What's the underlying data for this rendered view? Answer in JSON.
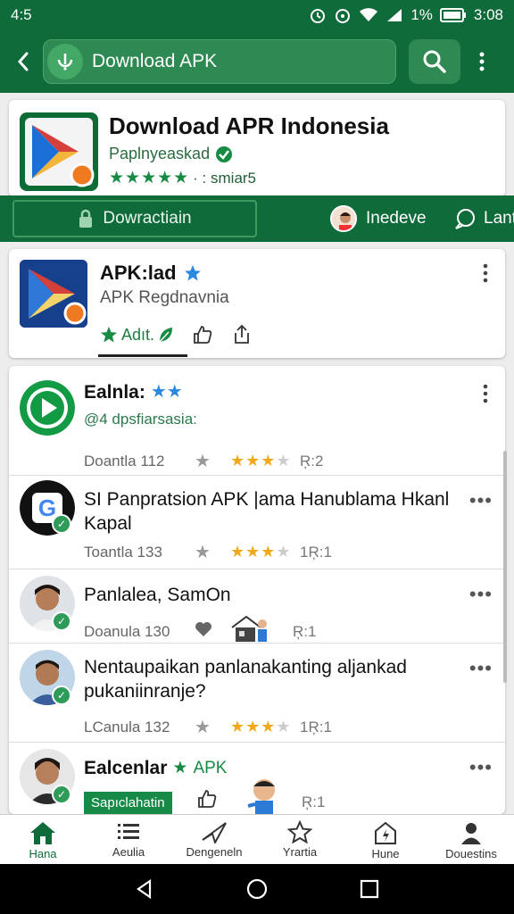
{
  "status": {
    "time": "4:5",
    "battery": "1%",
    "clock": "3:08"
  },
  "appbar": {
    "back_label": "Back",
    "search_text": "Download APK"
  },
  "hero": {
    "title": "Download APR Indonesia",
    "publisher": "Paplnyeaskad",
    "stars": "★★★★★",
    "rating_text": "· : smiar5"
  },
  "actions": {
    "download_label": "Dowractiain",
    "second_label": "Inedeve",
    "third_label": "Lant"
  },
  "apk_card": {
    "name": "APK:lad",
    "subtitle": "APK Regdnavnia",
    "add_label": "Adıt."
  },
  "feed": {
    "items": [
      {
        "title": "Ealnla:",
        "subtitle": "@4 dpsfiarsasia:",
        "meta_label": "Doantla 112",
        "count": "Ŗ:2"
      },
      {
        "title": "SI Panpratsion APK |ama Hanublama Hkanl Kapal",
        "meta_label": "Toantla 133",
        "count": "1Ŗ:1"
      },
      {
        "title": "Panlalea, SamOn",
        "meta_label": "Doanula 130",
        "count": "Ŗ:1"
      },
      {
        "title": "Nentaupaikan panlanakanting aljankad pukaniinranje?",
        "meta_label": "LCanula 132",
        "count": "1Ŗ:1"
      },
      {
        "title": "Ealcenlar",
        "title_tag": "APK",
        "tag_label": "Sapıclahatin",
        "count": "Ŗ:1"
      }
    ]
  },
  "bottom_nav": {
    "items": [
      {
        "label": "Hana"
      },
      {
        "label": "Aeulia"
      },
      {
        "label": "Dengeneln"
      },
      {
        "label": "Yrartia"
      },
      {
        "label": "Hune"
      },
      {
        "label": "Douestins"
      }
    ]
  },
  "colors": {
    "brand_green": "#0f6b3a",
    "accent_green": "#178a43",
    "star_orange": "#f0a91d",
    "blue_star": "#2a8ae0"
  }
}
